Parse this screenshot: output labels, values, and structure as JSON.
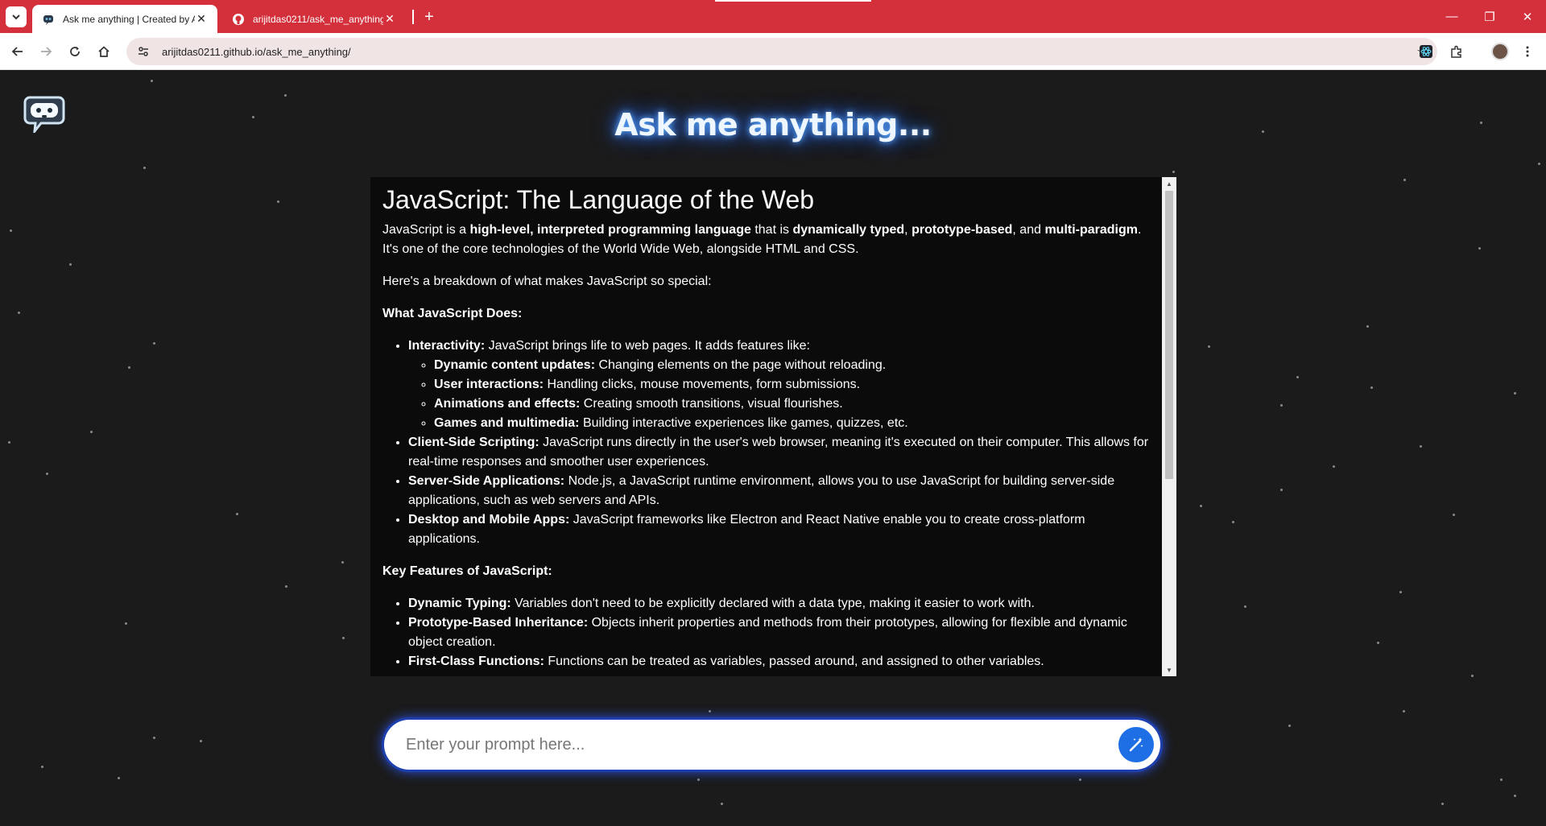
{
  "browser": {
    "tabs": [
      {
        "title": "Ask me anything | Created by A",
        "active": true
      },
      {
        "title": "arijitdas0211/ask_me_anything:",
        "active": false
      }
    ],
    "url": "arijitdas0211.github.io/ask_me_anything/",
    "window_controls": {
      "minimize": "—",
      "restore": "❐",
      "close": "✕"
    }
  },
  "app": {
    "title": "Ask me anything...",
    "accent_color": "#1e6fe5"
  },
  "response": {
    "heading": "JavaScript: The Language of the Web",
    "intro": {
      "t1": "JavaScript is a ",
      "b1": "high-level, interpreted programming language",
      "t2": " that is ",
      "b2": "dynamically typed",
      "t3": ", ",
      "b3": "prototype-based",
      "t4": ", and ",
      "b4": "multi-paradigm",
      "t5": ". It's one of the core technologies of the World Wide Web, alongside HTML and CSS."
    },
    "breakdown": "Here's a breakdown of what makes JavaScript so special:",
    "section1_title": "What JavaScript Does:",
    "section1_items": [
      {
        "label": "Interactivity:",
        "text": " JavaScript brings life to web pages. It adds features like:",
        "sub": [
          {
            "label": "Dynamic content updates:",
            "text": " Changing elements on the page without reloading."
          },
          {
            "label": "User interactions:",
            "text": " Handling clicks, mouse movements, form submissions."
          },
          {
            "label": "Animations and effects:",
            "text": " Creating smooth transitions, visual flourishes."
          },
          {
            "label": "Games and multimedia:",
            "text": " Building interactive experiences like games, quizzes, etc."
          }
        ]
      },
      {
        "label": "Client-Side Scripting:",
        "text": " JavaScript runs directly in the user's web browser, meaning it's executed on their computer. This allows for real-time responses and smoother user experiences."
      },
      {
        "label": "Server-Side Applications:",
        "text": " Node.js, a JavaScript runtime environment, allows you to use JavaScript for building server-side applications, such as web servers and APIs."
      },
      {
        "label": "Desktop and Mobile Apps:",
        "text": " JavaScript frameworks like Electron and React Native enable you to create cross-platform applications."
      }
    ],
    "section2_title": "Key Features of JavaScript:",
    "section2_items": [
      {
        "label": "Dynamic Typing:",
        "text": " Variables don't need to be explicitly declared with a data type, making it easier to work with."
      },
      {
        "label": "Prototype-Based Inheritance:",
        "text": " Objects inherit properties and methods from their prototypes, allowing for flexible and dynamic object creation."
      },
      {
        "label": "First-Class Functions:",
        "text": " Functions can be treated as variables, passed around, and assigned to other variables."
      }
    ]
  },
  "prompt": {
    "placeholder": "Enter your prompt here..."
  }
}
